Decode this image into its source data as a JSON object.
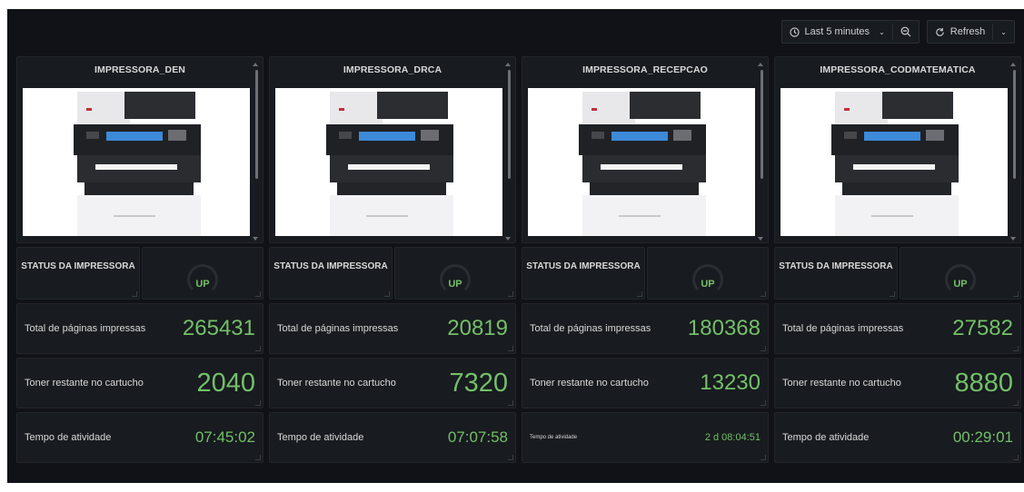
{
  "toolbar": {
    "time_range_label": "Last 5 minutes",
    "refresh_label": "Refresh"
  },
  "labels": {
    "status": "STATUS DA IMPRESSORA",
    "total_pages": "Total de páginas impressas",
    "toner": "Toner restante no cartucho",
    "uptime": "Tempo de atividade"
  },
  "printers": [
    {
      "name": "IMPRESSORA_DEN",
      "status": "UP",
      "total_pages": "265431",
      "toner": "2040",
      "uptime": "07:45:02"
    },
    {
      "name": "IMPRESSORA_DRCA",
      "status": "UP",
      "total_pages": "20819",
      "toner": "7320",
      "uptime": "07:07:58"
    },
    {
      "name": "IMPRESSORA_RECEPCAO",
      "status": "UP",
      "total_pages": "180368",
      "toner": "13230",
      "uptime": "2 d 08:04:51"
    },
    {
      "name": "IMPRESSORA_CODMATEMATICA",
      "status": "UP",
      "total_pages": "27582",
      "toner": "8880",
      "uptime": "00:29:01"
    }
  ],
  "colors": {
    "background": "#111217",
    "panel": "#181b1f",
    "value_green": "#73bf69"
  }
}
